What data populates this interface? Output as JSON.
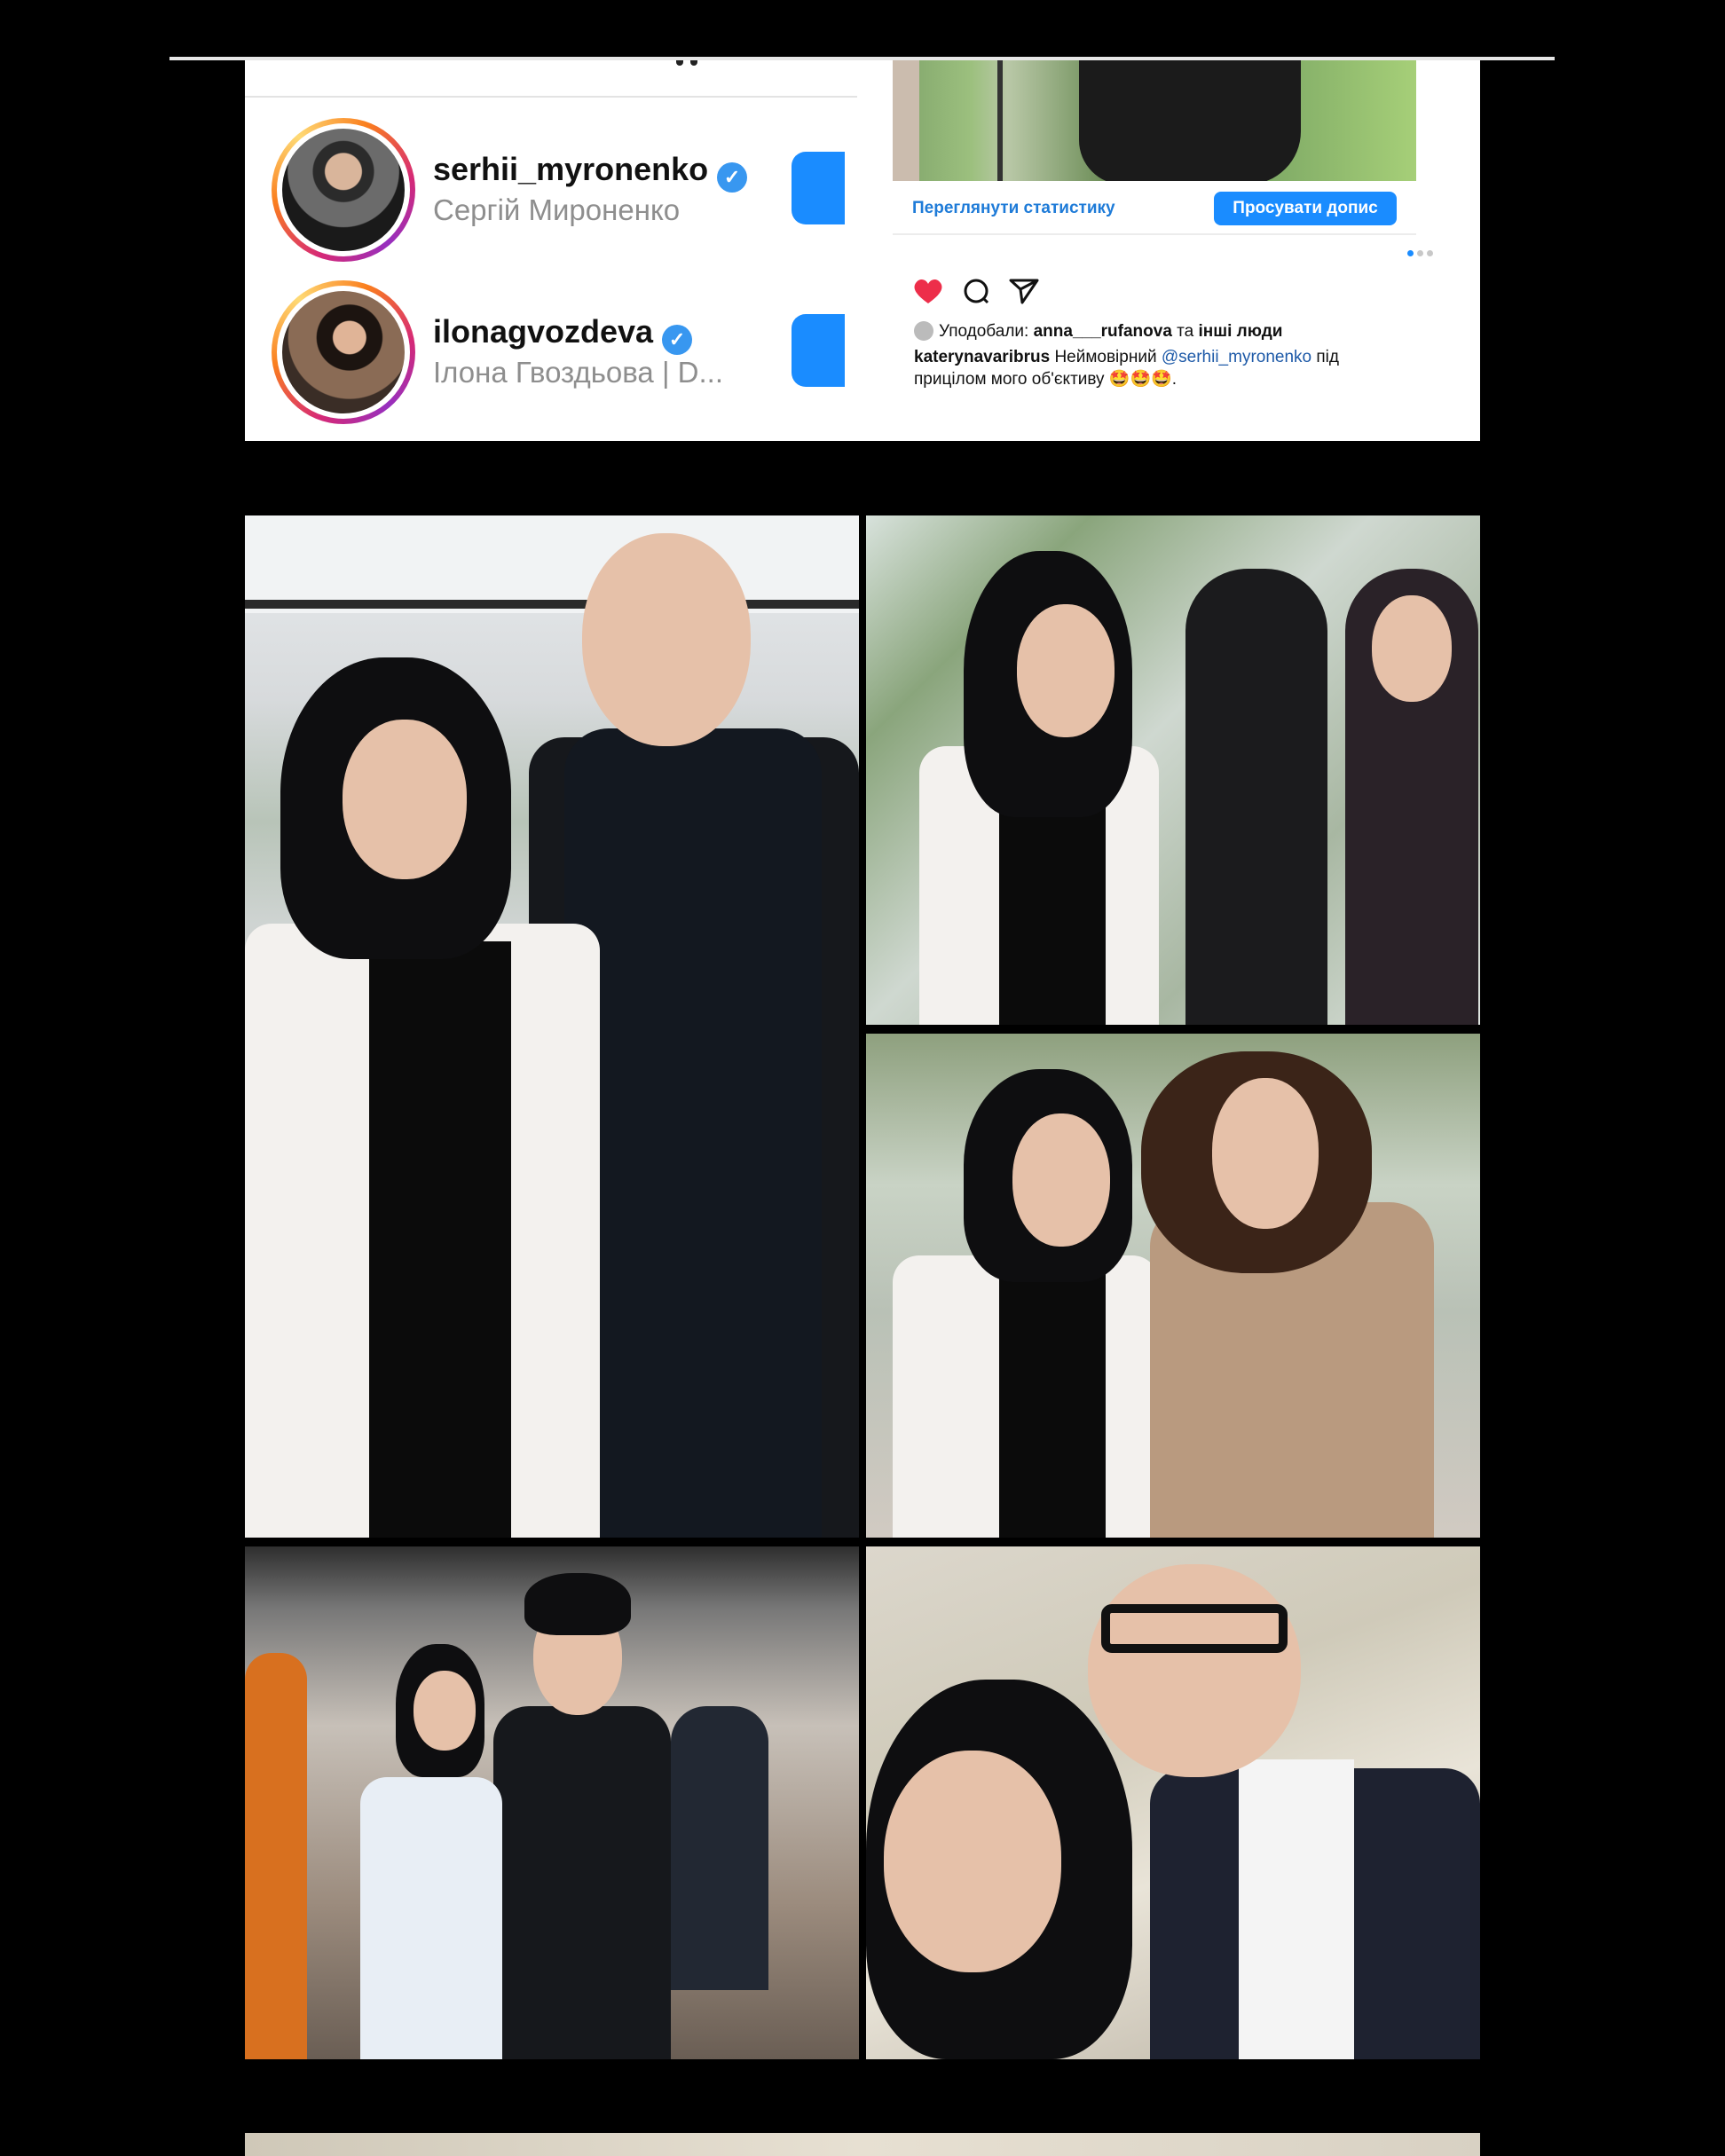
{
  "suggested_accounts": [
    {
      "username": "serhii_myronenko",
      "full_name": "Сергій Мироненко",
      "verified": true
    },
    {
      "username": "ilonagvozdeva",
      "full_name": "Ілона Гвоздьова | D...",
      "verified": true
    }
  ],
  "post": {
    "stats_link": "Переглянути статистику",
    "promote_button": "Просувати допис",
    "liked_by_prefix": "Уподобали:",
    "liked_by_user": "anna___rufanova",
    "liked_by_join": "та",
    "liked_by_others": "інші люди",
    "caption_author": "katerynavaribrus",
    "caption_text_1": "Неймовірний",
    "caption_mention": "@serhii_myronenko",
    "caption_text_2": "під прицілом мого об'єктиву 🤩🤩🤩.",
    "carousel_dots": 3,
    "carousel_active": 1
  },
  "icons": {
    "like": "heart-icon",
    "comment": "comment-icon",
    "share": "share-icon",
    "verified": "verified-badge-icon"
  },
  "colors": {
    "accent": "#1a8cff",
    "like": "#ed2e4a",
    "mention": "#1e5aa8"
  }
}
